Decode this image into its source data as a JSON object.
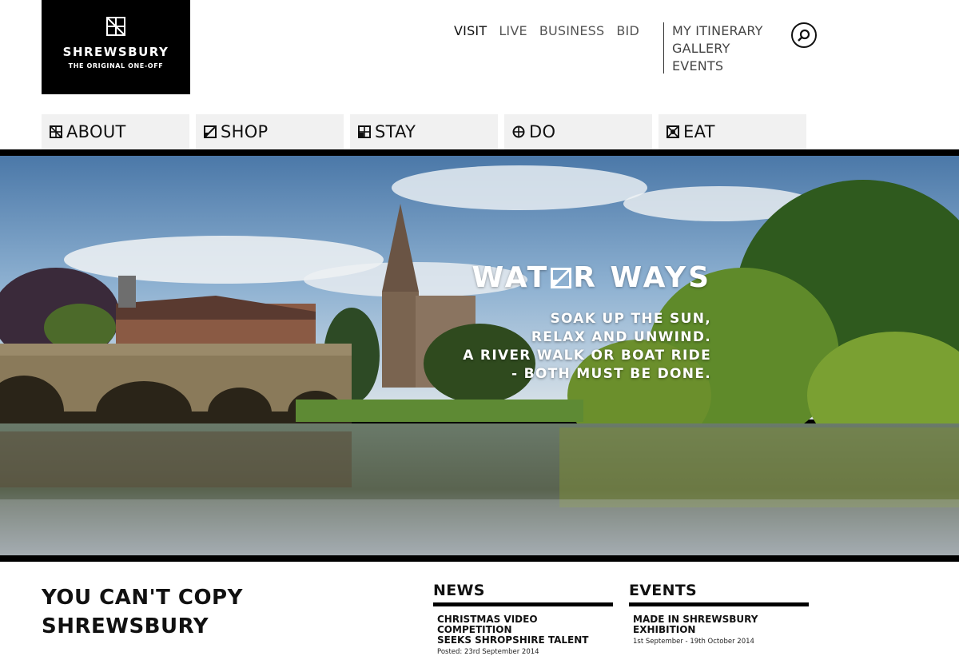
{
  "logo": {
    "name": "SHREWSBURY",
    "tagline": "THE ORIGINAL ONE-OFF"
  },
  "topnav": [
    "VISIT",
    "LIVE",
    "BUSINESS",
    "BID"
  ],
  "subnav": [
    "MY ITINERARY",
    "GALLERY",
    "EVENTS"
  ],
  "search": {
    "icon": "search-icon"
  },
  "mainnav": [
    {
      "label": "ABOUT",
      "icon": "about-icon"
    },
    {
      "label": "SHOP",
      "icon": "shop-icon"
    },
    {
      "label": "STAY",
      "icon": "stay-icon"
    },
    {
      "label": "DO",
      "icon": "do-icon"
    },
    {
      "label": "EAT",
      "icon": "eat-icon"
    }
  ],
  "hero": {
    "headline_left": "WAT",
    "headline_right": "R WAYS",
    "lines": [
      "SOAK UP THE SUN,",
      "RELAX AND UNWIND.",
      "A RIVER WALK OR BOAT RIDE",
      "- BOTH MUST BE DONE."
    ]
  },
  "intro": {
    "line1": "YOU CAN'T COPY",
    "line2": "SHREWSBURY"
  },
  "news": {
    "heading": "NEWS",
    "items": [
      {
        "title_l1": "CHRISTMAS VIDEO COMPETITION",
        "title_l2": "SEEKS SHROPSHIRE TALENT",
        "meta": "Posted: 23rd September 2014"
      }
    ]
  },
  "events": {
    "heading": "EVENTS",
    "items": [
      {
        "title_l1": "MADE IN SHREWSBURY",
        "title_l2": "EXHIBITION",
        "meta": "1st September - 19th October 2014"
      }
    ]
  },
  "colors": {
    "black": "#000000",
    "nav_bg": "#f1f1f1",
    "text_gray": "#555555"
  }
}
